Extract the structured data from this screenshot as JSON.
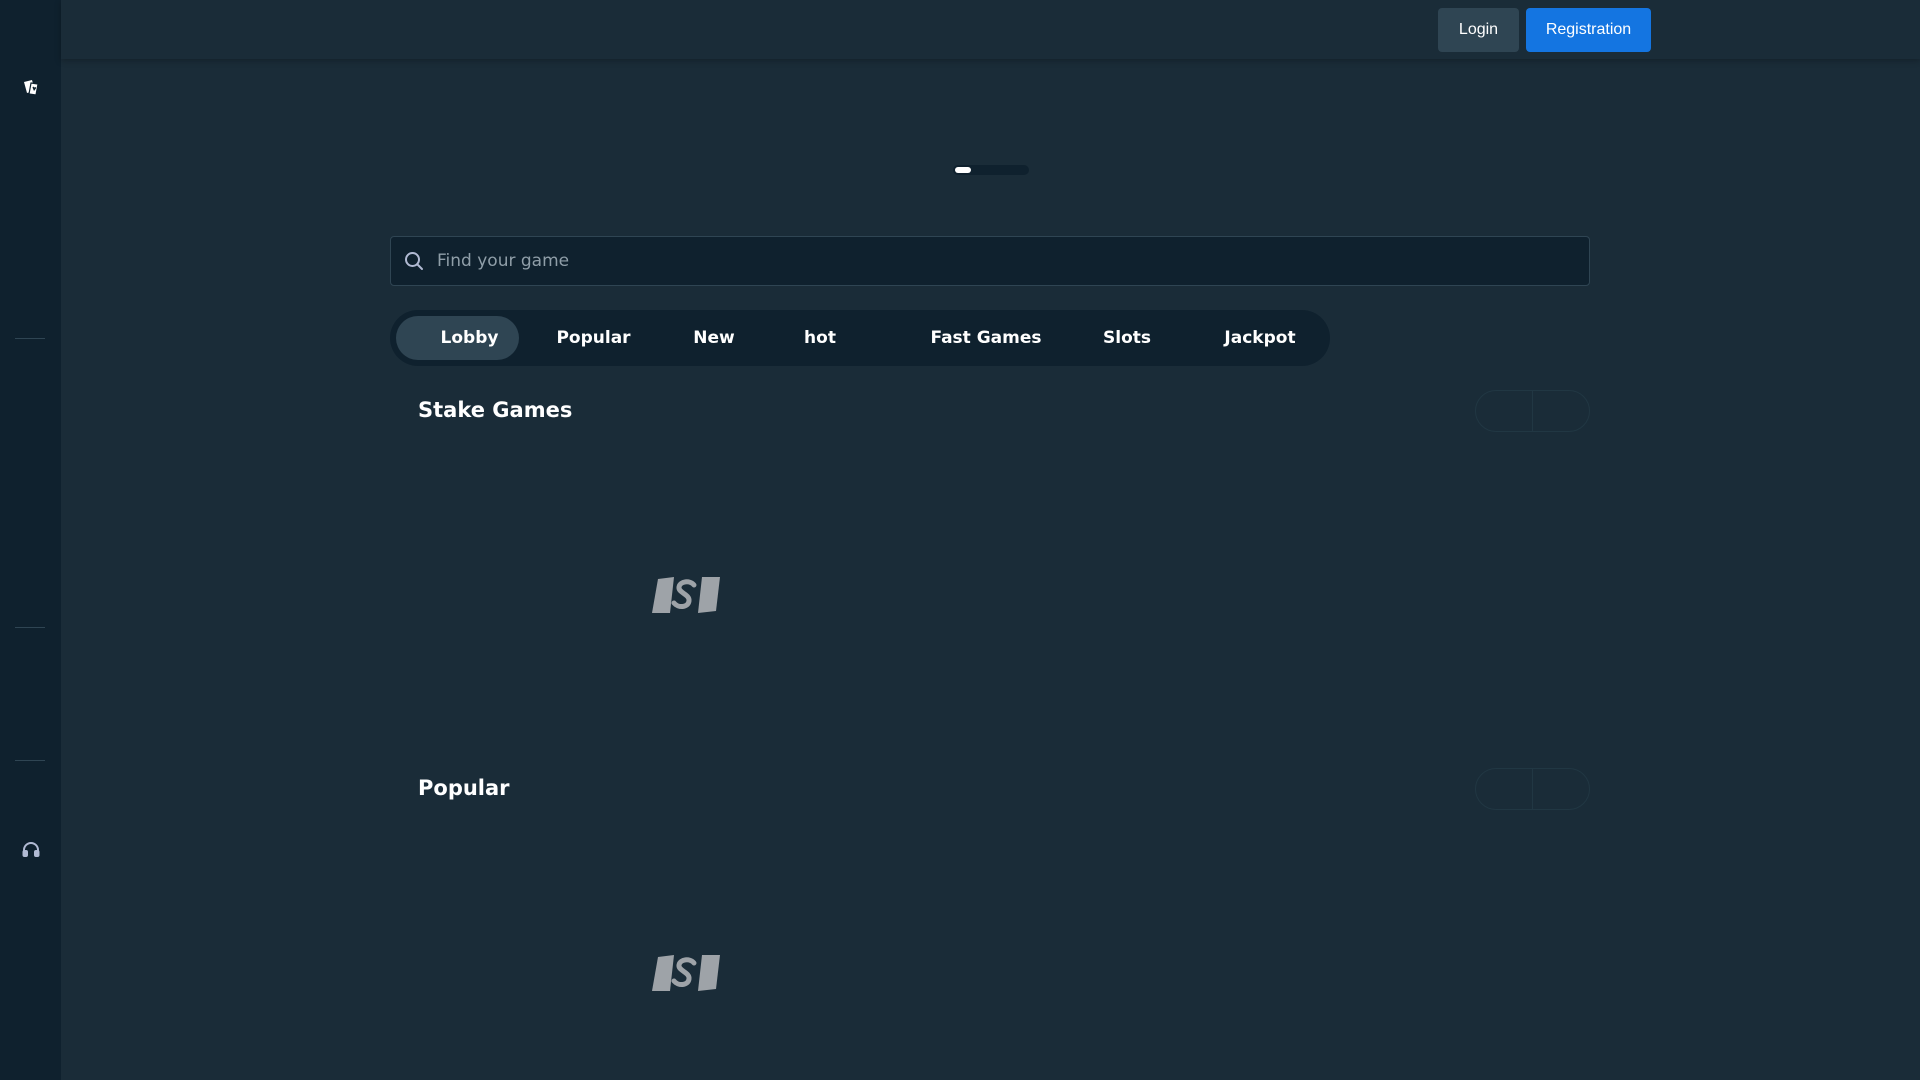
{
  "header": {
    "login_label": "Login",
    "register_label": "Registration"
  },
  "search": {
    "placeholder": "Find your game"
  },
  "tabs": [
    {
      "label": "Lobby",
      "active": true
    },
    {
      "label": "Popular",
      "active": false
    },
    {
      "label": "New",
      "active": false
    },
    {
      "label": "hot",
      "active": false
    },
    {
      "label": "Fast Games",
      "active": false
    },
    {
      "label": "Slots",
      "active": false
    },
    {
      "label": "Jackpot",
      "active": false
    }
  ],
  "sections": [
    {
      "title": "Stake Games"
    },
    {
      "title": "Popular"
    }
  ],
  "sidebar": {
    "icons": [
      "casino-cards-icon",
      "support-headset-icon"
    ]
  },
  "colors": {
    "background": "#1a2c38",
    "sidebar": "#0f212e",
    "accent": "#1475e1",
    "secondary_button": "#2f4553"
  }
}
